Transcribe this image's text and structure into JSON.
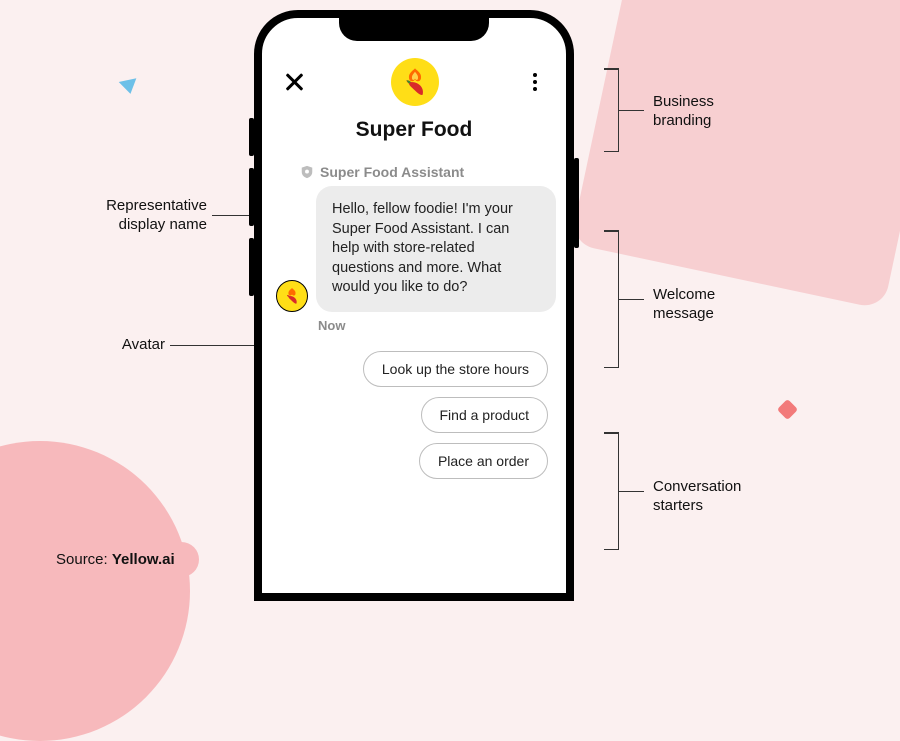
{
  "annotations": {
    "business_branding": "Business branding",
    "representative_display_name": "Representative display name",
    "welcome_message": "Welcome message",
    "avatar": "Avatar",
    "conversation_starters": "Conversation starters"
  },
  "source": {
    "prefix": "Source: ",
    "name": "Yellow.ai"
  },
  "chat": {
    "brand_title": "Super Food",
    "rep_name": "Super Food Assistant",
    "welcome_text": "Hello, fellow foodie! I'm your Super Food Assistant. I can help with store-related questions and more. What would you like to do?",
    "timestamp": "Now",
    "quick_replies": [
      "Look up the store hours",
      "Find a product",
      "Place an order"
    ]
  },
  "colors": {
    "brand_yellow": "#ffde17",
    "background_pink": "#fbf0f0",
    "accent_pink": "#f7b9bc"
  }
}
